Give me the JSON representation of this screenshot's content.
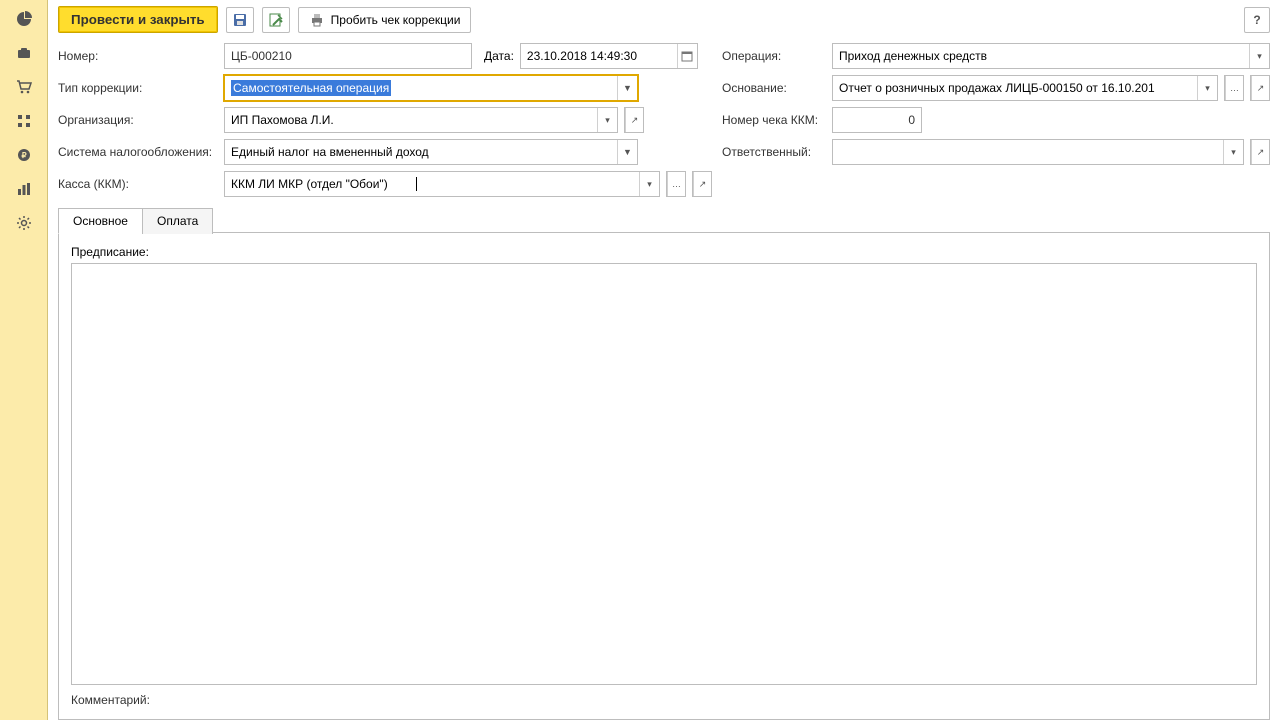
{
  "toolbar": {
    "post_close": "Провести и закрыть",
    "print_check": "Пробить чек коррекции",
    "help": "?"
  },
  "labels": {
    "number": "Номер:",
    "date": "Дата:",
    "correction_type": "Тип коррекции:",
    "organization": "Организация:",
    "tax_system": "Система налогообложения:",
    "kassa": "Касса (ККМ):",
    "operation": "Операция:",
    "basis": "Основание:",
    "kkm_check_no": "Номер чека ККМ:",
    "responsible": "Ответственный:",
    "prescription": "Предписание:",
    "comment": "Комментарий:"
  },
  "values": {
    "number": "ЦБ-000210",
    "date": "23.10.2018 14:49:30",
    "correction_type": "Самостоятельная операция",
    "organization": "ИП Пахомова Л.И.",
    "tax_system": "Единый налог на вмененный доход",
    "kassa": "ККМ ЛИ МКР (отдел \"Обои\")",
    "operation": "Приход денежных средств",
    "basis": "Отчет о розничных продажах ЛИЦБ-000150 от 16.10.201",
    "kkm_check_no": "0",
    "responsible": ""
  },
  "tabs": {
    "main": "Основное",
    "payment": "Оплата"
  }
}
